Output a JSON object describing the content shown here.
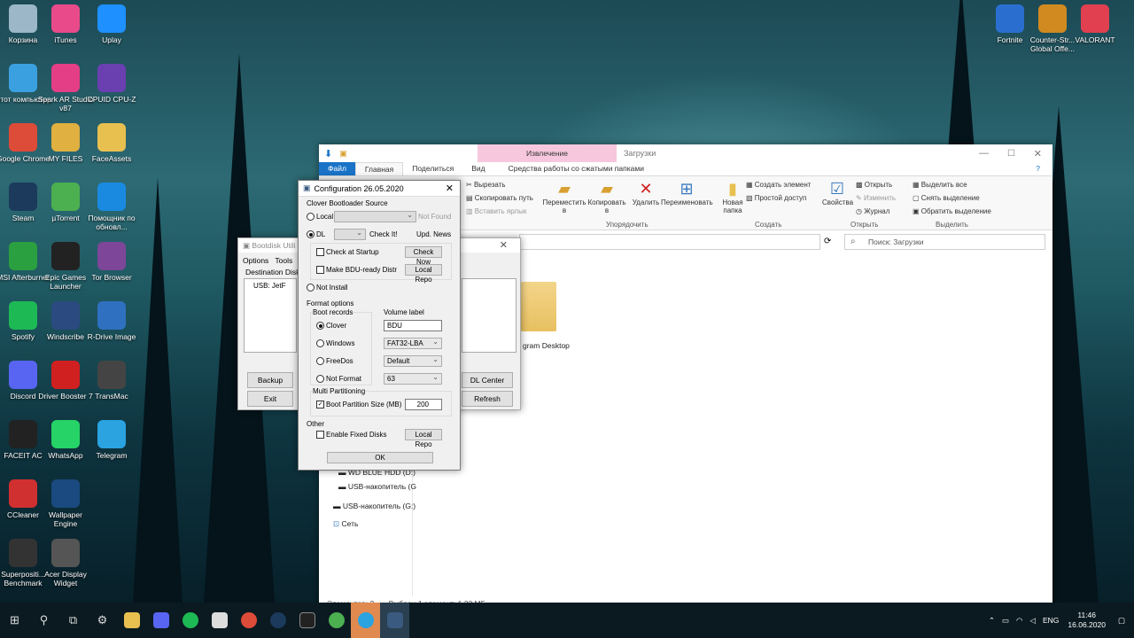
{
  "desktop": {
    "icons": [
      {
        "label": "Корзина",
        "icon": "recycle-bin-icon",
        "color": "#9bb7c8"
      },
      {
        "label": "iTunes",
        "icon": "itunes-icon",
        "color": "#e84a8a"
      },
      {
        "label": "Uplay",
        "icon": "uplay-icon",
        "color": "#1e90ff"
      },
      {
        "label": "Этот компьютер",
        "icon": "computer-icon",
        "color": "#3aa0e0"
      },
      {
        "label": "Spark AR Studio v87",
        "icon": "spark-ar-icon",
        "color": "#e33e86"
      },
      {
        "label": "CPUID CPU-Z",
        "icon": "cpuz-icon",
        "color": "#6a3fb0"
      },
      {
        "label": "Google Chrome",
        "icon": "chrome-icon",
        "color": "#dd4b39"
      },
      {
        "label": "MY FILES",
        "icon": "folder-icon",
        "color": "#e0b040"
      },
      {
        "label": "FaceAssets",
        "icon": "folder-icon",
        "color": "#e8c050"
      },
      {
        "label": "Steam",
        "icon": "steam-icon",
        "color": "#1b3a5c"
      },
      {
        "label": "µTorrent",
        "icon": "utorrent-icon",
        "color": "#4caf50"
      },
      {
        "label": "Помощник по обновл...",
        "icon": "windows-icon",
        "color": "#1a8ae0"
      },
      {
        "label": "MSI Afterburner",
        "icon": "msi-icon",
        "color": "#2aa040"
      },
      {
        "label": "Epic Games Launcher",
        "icon": "epic-icon",
        "color": "#222222"
      },
      {
        "label": "Tor Browser",
        "icon": "tor-icon",
        "color": "#7d4698"
      },
      {
        "label": "Spotify",
        "icon": "spotify-icon",
        "color": "#1db954"
      },
      {
        "label": "Windscribe",
        "icon": "windscribe-icon",
        "color": "#2a4a80"
      },
      {
        "label": "R-Drive Image",
        "icon": "rdrive-icon",
        "color": "#3070c0"
      },
      {
        "label": "Discord",
        "icon": "discord-icon",
        "color": "#5865f2"
      },
      {
        "label": "Driver Booster 7",
        "icon": "driver-booster-icon",
        "color": "#d02020"
      },
      {
        "label": "TransMac",
        "icon": "transmac-icon",
        "color": "#444444"
      },
      {
        "label": "FACEIT AC",
        "icon": "faceit-icon",
        "color": "#222222"
      },
      {
        "label": "WhatsApp",
        "icon": "whatsapp-icon",
        "color": "#25d366"
      },
      {
        "label": "Telegram",
        "icon": "telegram-icon",
        "color": "#2aa3e0"
      },
      {
        "label": "CCleaner",
        "icon": "ccleaner-icon",
        "color": "#d03030"
      },
      {
        "label": "Wallpaper Engine",
        "icon": "wallpaper-engine-icon",
        "color": "#1a4a80"
      },
      {
        "label": "Superpositi... Benchmark",
        "icon": "superposition-icon",
        "color": "#333333"
      },
      {
        "label": "Acer Display Widget",
        "icon": "acer-icon",
        "color": "#555555"
      },
      {
        "label": "Fortnite",
        "icon": "fortnite-icon",
        "color": "#2a6fd0"
      },
      {
        "label": "Counter-Str... Global Offe...",
        "icon": "csgo-icon",
        "color": "#d08a20"
      },
      {
        "label": "VALORANT",
        "icon": "valorant-icon",
        "color": "#e04050"
      }
    ]
  },
  "explorer": {
    "title": "Загрузки",
    "context_tab": "Извлечение",
    "context_sub": "Средства работы со сжатыми папками",
    "tabs": [
      "Файл",
      "Главная",
      "Поделиться",
      "Вид"
    ],
    "ribbon": {
      "clipboard": [
        "Вырезать",
        "Скопировать путь",
        "Вставить ярлык"
      ],
      "move": "Переместить в",
      "copy": "Копировать в",
      "delete": "Удалить",
      "rename": "Переименовать",
      "group_organize": "Упорядочить",
      "new_folder": "Новая папка",
      "new_item": "Создать элемент",
      "easy_access": "Простой доступ",
      "group_new": "Создать",
      "properties": "Свойства",
      "open": "Открыть",
      "edit": "Изменить",
      "history": "Журнал",
      "group_open": "Открыть",
      "select_all": "Выделить все",
      "select_none": "Снять выделение",
      "invert": "Обратить выделение",
      "group_select": "Выделить"
    },
    "search_placeholder": "Поиск: Загрузки",
    "file_label": "gram Desktop",
    "nav": [
      "WD BLUE HDD (D:)",
      "USB-накопитель (G",
      "USB-накопитель (G:)",
      "Сеть"
    ],
    "status_items": "Элементов: 2",
    "status_selected": "Выбран 1 элемент: 1,32 МБ"
  },
  "bootdisk": {
    "title": "Bootdisk Utili",
    "menu": [
      "Options",
      "Tools"
    ],
    "dest_label": "Destination Disk",
    "disk_item": "USB: JetF",
    "buttons": {
      "backup": "Backup",
      "exit": "Exit",
      "dl_center": "DL Center",
      "refresh": "Refresh"
    }
  },
  "config": {
    "title": "Configuration 26.05.2020",
    "source_group": "Clover Bootloader Source",
    "local": "Local",
    "not_found": "Not Found",
    "dl": "DL",
    "check_it": "Check It!",
    "upd_news": "Upd. News",
    "check_startup": "Check at Startup",
    "check_now": "Check Now",
    "make_bdu": "Make BDU-ready Distr",
    "local_repo": "Local Repo",
    "not_install": "Not Install",
    "format_group": "Format options",
    "boot_records": "Boot records",
    "volume_label": "Volume label",
    "volume_value": "BDU",
    "records": [
      "Clover",
      "Windows",
      "FreeDos",
      "Not Format"
    ],
    "selects": [
      "FAT32-LBA",
      "Default",
      "63"
    ],
    "multi": "Multi Partitioning",
    "boot_size": "Boot Partition Size (MB)",
    "boot_size_value": "200",
    "other": "Other",
    "fixed_disks": "Enable Fixed Disks",
    "local_repo2": "Local Repo",
    "ok": "OK"
  },
  "taskbar": {
    "lang": "ENG",
    "time": "11:46",
    "date": "16.06.2020"
  }
}
